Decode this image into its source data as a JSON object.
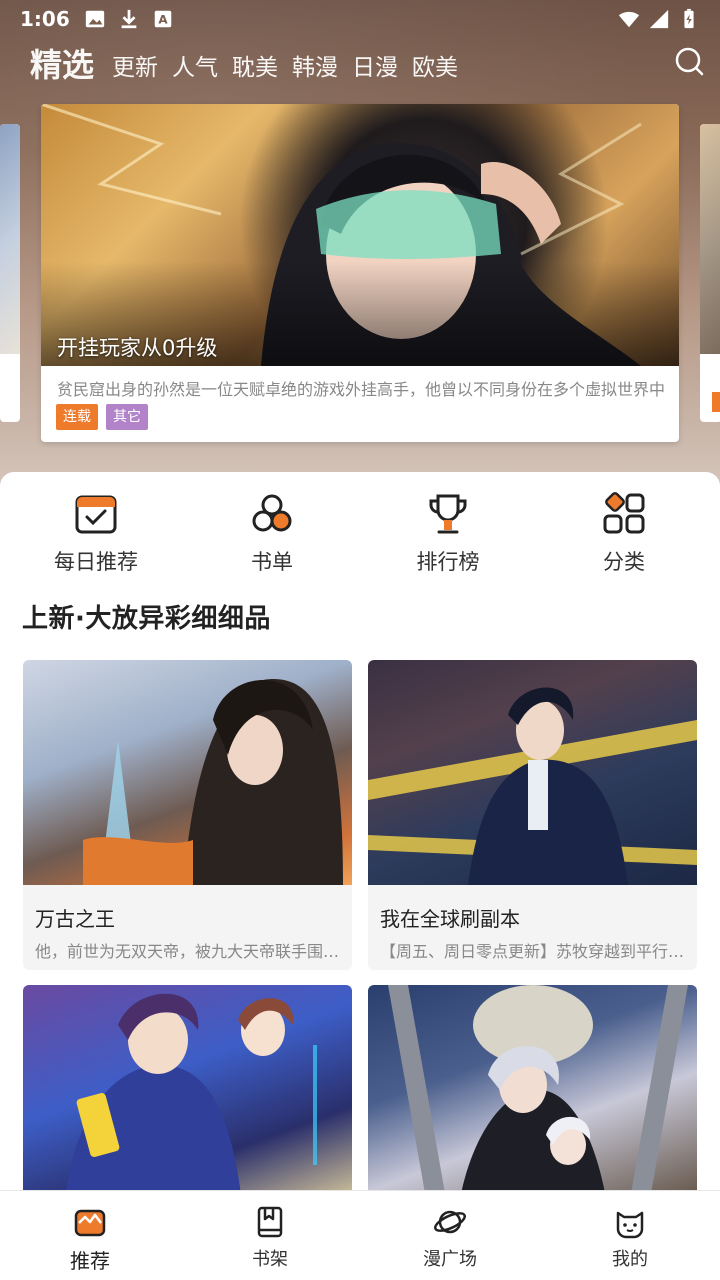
{
  "status_bar": {
    "time": "1:06"
  },
  "top_nav": {
    "tabs": [
      {
        "label": "精选",
        "active": true
      },
      {
        "label": "更新"
      },
      {
        "label": "人气"
      },
      {
        "label": "耽美"
      },
      {
        "label": "韩漫"
      },
      {
        "label": "日漫"
      },
      {
        "label": "欧美"
      }
    ]
  },
  "banner": {
    "title": "开挂玩家从0升级",
    "description": "贫民窟出身的孙然是一位天赋卓绝的游戏外挂高手，他曾以不同身份在多个虚拟世界中",
    "tags": [
      {
        "label": "连载",
        "color": "#ee7b2c"
      },
      {
        "label": "其它",
        "color": "#b383c9"
      }
    ]
  },
  "quick_links": [
    {
      "label": "每日推荐",
      "icon": "calendar-check-icon"
    },
    {
      "label": "书单",
      "icon": "three-circles-icon"
    },
    {
      "label": "排行榜",
      "icon": "trophy-icon"
    },
    {
      "label": "分类",
      "icon": "category-grid-icon"
    }
  ],
  "section": {
    "title": "上新·大放异彩细细品"
  },
  "comics": [
    {
      "title": "万古之王",
      "description": "他，前世为无双天帝，被九大天帝联手围攻陨落"
    },
    {
      "title": "我在全球刷副本",
      "description": "【周五、周日零点更新】苏牧穿越到平行世界"
    },
    {
      "title": "",
      "description": ""
    },
    {
      "title": "",
      "description": ""
    }
  ],
  "bottom_nav": [
    {
      "label": "推荐",
      "active": true
    },
    {
      "label": "书架"
    },
    {
      "label": "漫广场"
    },
    {
      "label": "我的"
    }
  ],
  "colors": {
    "accent": "#ee7b2c",
    "tag_purple": "#b383c9"
  }
}
